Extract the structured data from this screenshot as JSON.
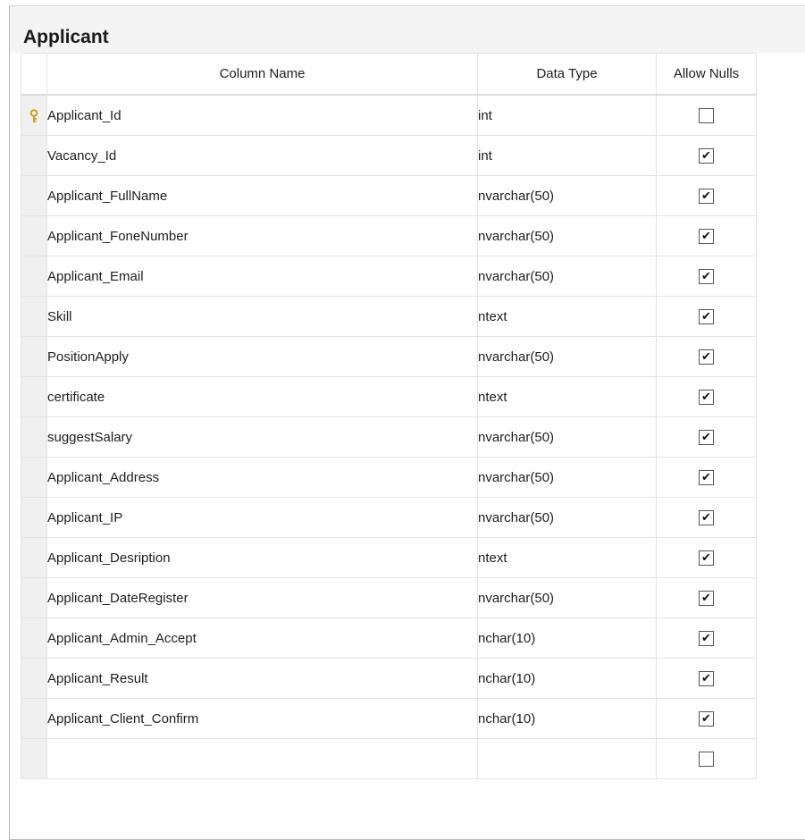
{
  "table": {
    "title": "Applicant",
    "headers": {
      "column_name": "Column Name",
      "data_type": "Data Type",
      "allow_nulls": "Allow Nulls"
    },
    "rows": [
      {
        "name": "Applicant_Id",
        "type": "int",
        "allow_nulls": false,
        "primary_key": true,
        "key_icon": "primary-key-icon"
      },
      {
        "name": "Vacancy_Id",
        "type": "int",
        "allow_nulls": true
      },
      {
        "name": "Applicant_FullName",
        "type": "nvarchar(50)",
        "allow_nulls": true
      },
      {
        "name": "Applicant_FoneNumber",
        "type": "nvarchar(50)",
        "allow_nulls": true
      },
      {
        "name": "Applicant_Email",
        "type": "nvarchar(50)",
        "allow_nulls": true
      },
      {
        "name": "Skill",
        "type": "ntext",
        "allow_nulls": true
      },
      {
        "name": "PositionApply",
        "type": "nvarchar(50)",
        "allow_nulls": true
      },
      {
        "name": "certificate",
        "type": "ntext",
        "allow_nulls": true
      },
      {
        "name": "suggestSalary",
        "type": "nvarchar(50)",
        "allow_nulls": true
      },
      {
        "name": "Applicant_Address",
        "type": "nvarchar(50)",
        "allow_nulls": true
      },
      {
        "name": "Applicant_IP",
        "type": "nvarchar(50)",
        "allow_nulls": true
      },
      {
        "name": "Applicant_Desription",
        "type": "ntext",
        "allow_nulls": true
      },
      {
        "name": "Applicant_DateRegister",
        "type": "nvarchar(50)",
        "allow_nulls": true
      },
      {
        "name": "Applicant_Admin_Accept",
        "type": "nchar(10)",
        "allow_nulls": true
      },
      {
        "name": "Applicant_Result",
        "type": "nchar(10)",
        "allow_nulls": true
      },
      {
        "name": "Applicant_Client_Confirm",
        "type": "nchar(10)",
        "allow_nulls": true
      },
      {
        "name": "",
        "type": "",
        "allow_nulls": false
      }
    ]
  },
  "colors": {
    "key_icon": "#c9a227",
    "grid_line": "#e3e3e3",
    "row_selector": "#f0f0f0"
  }
}
